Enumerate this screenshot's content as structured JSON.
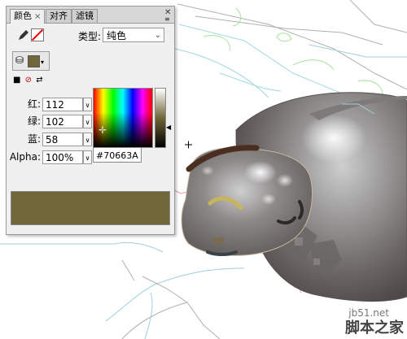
{
  "panel": {
    "tabs": [
      {
        "label": "颜色",
        "active": true
      },
      {
        "label": "对齐",
        "active": false
      },
      {
        "label": "滤镜",
        "active": false
      }
    ],
    "type_label": "类型:",
    "type_value": "纯色",
    "fields": {
      "red": {
        "label": "红:",
        "value": "112"
      },
      "green": {
        "label": "绿:",
        "value": "102"
      },
      "blue": {
        "label": "蓝:",
        "value": "58"
      },
      "alpha": {
        "label": "Alpha:",
        "value": "100%"
      }
    },
    "hex": "#70663A",
    "fill_color": "#70663a",
    "stroke_color": "#ff0000"
  },
  "watermark": {
    "site": "jb51.net",
    "name": "脚本之家"
  }
}
